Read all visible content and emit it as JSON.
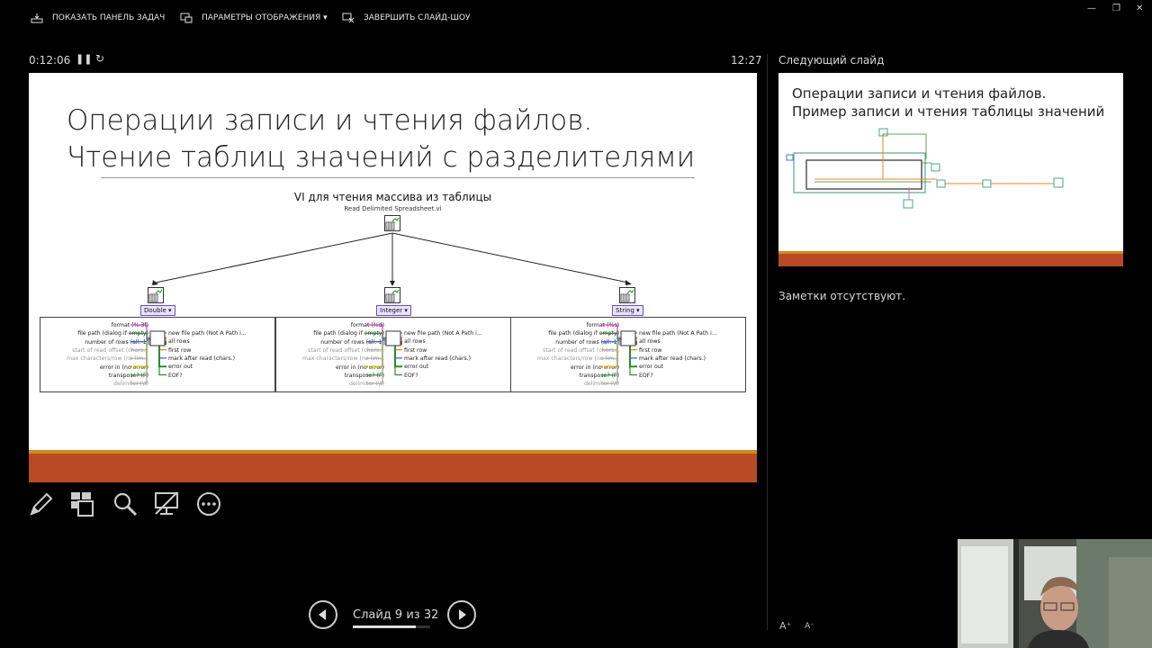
{
  "topbar": {
    "show_taskbar": "ПОКАЗАТЬ ПАНЕЛЬ ЗАДАЧ",
    "display_settings": "ПАРАМЕТРЫ ОТОБРАЖЕНИЯ ▾",
    "end_show": "ЗАВЕРШИТЬ СЛАЙД-ШОУ"
  },
  "timer": {
    "elapsed": "0:12:06",
    "clock": "12:27"
  },
  "slide": {
    "title": "Операции записи и чтения файлов.\nЧтение таблиц значений с разделителями",
    "vi_heading": "VI для чтения массива из таблицы",
    "vi_name": "Read Delimited Spreadsheet.vi",
    "panels": [
      {
        "selector": "Double ▾",
        "inputs": [
          {
            "label": "format (%.3f)",
            "grey": false
          },
          {
            "label": "file path (dialog if empty)",
            "grey": false
          },
          {
            "label": "number of rows (all:-1)",
            "grey": false
          },
          {
            "label": "start of read offset (chars...",
            "grey": true
          },
          {
            "label": "max characters/row (no lim...",
            "grey": true
          },
          {
            "label": "error in (no error)",
            "grey": false
          },
          {
            "label": "transpose? (F)",
            "grey": false
          },
          {
            "label": "delimiter (\\t)",
            "grey": true
          }
        ],
        "outputs": [
          "new file path (Not A Path i...",
          "all rows",
          "first row",
          "mark after read (chars.)",
          "error out",
          "EOF?"
        ]
      },
      {
        "selector": "Integer ▾",
        "inputs": [
          {
            "label": "format (%d)",
            "grey": false
          },
          {
            "label": "file path (dialog if empty)",
            "grey": false
          },
          {
            "label": "number of rows (all:-1)",
            "grey": false
          },
          {
            "label": "start of read offset (chars...",
            "grey": true
          },
          {
            "label": "max characters/row (no lim...",
            "grey": true
          },
          {
            "label": "error in (no error)",
            "grey": false
          },
          {
            "label": "transpose? (F)",
            "grey": false
          },
          {
            "label": "delimiter (\\t)",
            "grey": true
          }
        ],
        "outputs": [
          "new file path (Not A Path i...",
          "all rows",
          "first row",
          "mark after read (chars.)",
          "error out",
          "EOF?"
        ]
      },
      {
        "selector": "String ▾",
        "inputs": [
          {
            "label": "format (%s)",
            "grey": false
          },
          {
            "label": "file path (dialog if empty)",
            "grey": false
          },
          {
            "label": "number of rows (all:-1)",
            "grey": false
          },
          {
            "label": "start of read offset (chars...",
            "grey": true
          },
          {
            "label": "max characters/row (no lim...",
            "grey": true
          },
          {
            "label": "error in (no error)",
            "grey": false
          },
          {
            "label": "transpose? (F)",
            "grey": false
          },
          {
            "label": "delimiter (\\t)",
            "grey": true
          }
        ],
        "outputs": [
          "new file path (Not A Path i...",
          "all rows",
          "first row",
          "mark after read (chars.)",
          "error out",
          "EOF?"
        ]
      }
    ]
  },
  "next_slide": {
    "label": "Следующий слайд",
    "title": "Операции записи и чтения файлов.\nПример записи и чтения таблицы значений"
  },
  "notes": "Заметки отсутствуют.",
  "navigation": {
    "counter": "Слайд 9 из 32",
    "current": 9,
    "total": 32
  },
  "colors": {
    "accent_orange": "#d28a1e",
    "accent_rust": "#b84a25",
    "wire_pink": "#e040c8",
    "wire_orange": "#e8862a",
    "wire_green": "#2e8b2e"
  }
}
